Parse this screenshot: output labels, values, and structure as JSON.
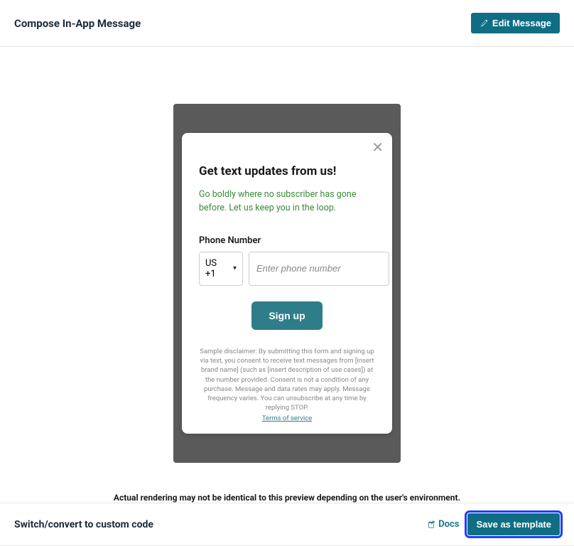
{
  "header": {
    "title": "Compose In-App Message",
    "edit_button": "Edit Message"
  },
  "preview": {
    "modal": {
      "title": "Get text updates from us!",
      "subtitle": "Go boldly where no subscriber has gone before. Let us keep you in the loop.",
      "phone_label": "Phone Number",
      "country_code": "US +1",
      "phone_placeholder": "Enter phone number",
      "signup_button": "Sign up",
      "disclaimer": "Sample disclaimer: By submitting this form and signing up via text, you consent to receive text messages from [insert brand name] (such as [insert description of use cases]) at the number provided. Consent is not a condition of any purchase. Message and data rates may apply. Message frequency varies. You can unsubscribe at any time by replying STOP.",
      "tos_link": "Terms of service"
    },
    "render_note": "Actual rendering may not be identical to this preview depending on the user's environment."
  },
  "footer": {
    "switch_label": "Switch/convert to custom code",
    "docs_label": "Docs",
    "save_template_label": "Save as template"
  }
}
